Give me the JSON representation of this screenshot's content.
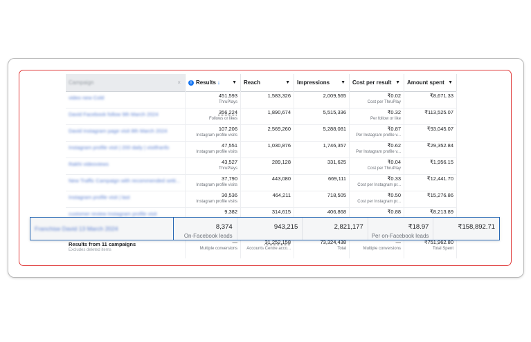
{
  "columns": {
    "campaign": "Campaign",
    "results": "Results",
    "reach": "Reach",
    "impressions": "Impressions",
    "cost_per_result": "Cost per result",
    "amount_spent": "Amount spent"
  },
  "rows": [
    {
      "name": "video new Cold",
      "results": "451,593",
      "results_sub": "ThruPlays",
      "reach": "1,583,326",
      "impressions": "2,009,565",
      "cpr": "₹0.02",
      "cpr_sub": "Cost per ThruPlay",
      "spent": "₹8,671.33"
    },
    {
      "name": "David Facebook follow 9th March 2024",
      "results": "356,224",
      "results_sub": "Follows or likes",
      "reach": "1,890,674",
      "impressions": "5,515,336",
      "cpr": "₹0.32",
      "cpr_sub": "Per follow or like",
      "spent": "₹113,525.07"
    },
    {
      "name": "David Instagram page visit 8th March 2024",
      "results": "107,206",
      "results_sub": "Instagram profile visits",
      "reach": "2,569,260",
      "impressions": "5,288,081",
      "cpr": "₹0.87",
      "cpr_sub": "Per Instagram profile v...",
      "spent": "₹93,045.07"
    },
    {
      "name": "Instagram profile visit | 200 daily | visitfranfo",
      "results": "47,551",
      "results_sub": "Instagram profile visits",
      "reach": "1,030,876",
      "impressions": "1,746,357",
      "cpr": "₹0.62",
      "cpr_sub": "Per Instagram profile v...",
      "spent": "₹29,352.84"
    },
    {
      "name": "Rakhi videoviews",
      "results": "43,527",
      "results_sub": "ThruPlays",
      "reach": "289,128",
      "impressions": "331,625",
      "cpr": "₹0.04",
      "cpr_sub": "Cost per ThruPlay",
      "spent": "₹1,956.15"
    },
    {
      "name": "New Traffic Campaign with recommended setti...",
      "results": "37,790",
      "results_sub": "Instagram profile visits",
      "reach": "443,080",
      "impressions": "669,111",
      "cpr": "₹0.33",
      "cpr_sub": "Cost per Instagram pr...",
      "spent": "₹12,441.70"
    },
    {
      "name": "Instagram profile visit | last",
      "results": "30,536",
      "results_sub": "Instagram profile visits",
      "reach": "464,211",
      "impressions": "718,505",
      "cpr": "₹0.50",
      "cpr_sub": "Cost per Instagram pr...",
      "spent": "₹15,276.86"
    },
    {
      "name": "customer review Instagram profile visit",
      "results": "9,382",
      "results_sub": "",
      "reach": "314,615",
      "impressions": "406,868",
      "cpr": "₹0.88",
      "cpr_sub": "",
      "spent": "₹8,213.89"
    }
  ],
  "highlight": {
    "name": "Franchise David 13 March 2024",
    "results": "8,374",
    "results_sub": "On-Facebook leads",
    "reach": "943,215",
    "impressions": "2,821,177",
    "cpr": "₹18.97",
    "cpr_sub": "Per on-Facebook leads",
    "spent": "₹158,892.71"
  },
  "footer": {
    "title": "Results from 11 campaigns",
    "subtitle": "Excludes deleted items",
    "results": "—",
    "results_sub": "Multiple conversions",
    "reach": "31,252,158",
    "reach_sub": "Accounts Centre acco...",
    "impressions": "73,324,438",
    "impressions_sub": "Total",
    "cpr": "—",
    "cpr_sub": "Multiple conversions",
    "spent": "₹751,962.80",
    "spent_sub": "Total Spent"
  },
  "colors": {
    "accent": "#1877f2",
    "highlight_border": "#2767b3",
    "frame": "#e03a3a"
  }
}
